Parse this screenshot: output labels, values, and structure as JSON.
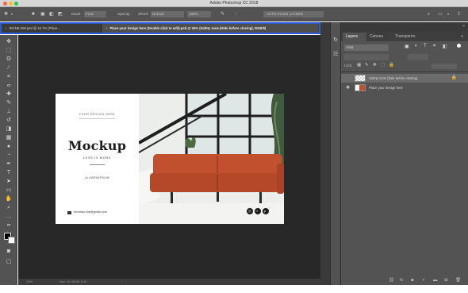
{
  "window": {
    "title": "Adobe Photoshop CC 2018"
  },
  "options_bar": {
    "mode_label": "Mode:",
    "mode_value": "Fuse",
    "opacity_label": "Opacity:",
    "align_label": "Shrink",
    "field_value": "Normal",
    "mode_field": "100%",
    "right_label": "AUTO-ALIGN LAYERS"
  },
  "document_tabs": [
    {
      "label": "SIGNE-350.psd @ 16.7% (Place..."
    },
    {
      "label": "Place your design here (Double click to edit).psb @ 25% (Safety zone (Hide before closing), RGB/8)"
    }
  ],
  "canvas": {
    "mockup": {
      "tagline": "YOUR DESIGN HERE",
      "title": "Mockup",
      "subtitle": "LESS IS MORE",
      "subtitle2": "#LOREMIPSUM",
      "email": "envimax.live@gmail.com"
    }
  },
  "status_bar": {
    "zoom": "25%",
    "doc_info": "Doc: 51.3M/51.3 M"
  },
  "layers_panel": {
    "tabs": [
      "Layers",
      "Canvas",
      "Transparen"
    ],
    "filter_label": "Kind",
    "lock_label": "Lock:",
    "layers": [
      {
        "name": "Safety zone (hide before closing)",
        "visible": false,
        "locked": true,
        "selected": true
      },
      {
        "name": "Place your design here",
        "visible": true,
        "locked": false,
        "selected": false
      }
    ]
  }
}
